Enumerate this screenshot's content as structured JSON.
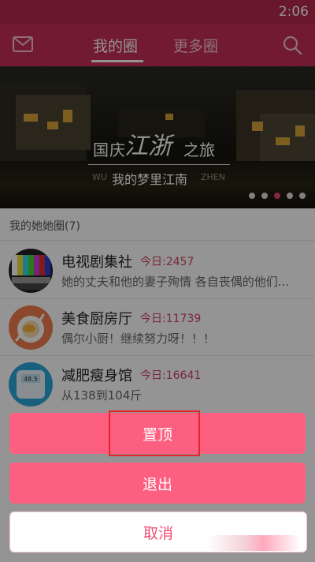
{
  "status_bar": {
    "time": "2:06"
  },
  "header": {
    "tabs": [
      {
        "label": "我的圈",
        "active": true
      },
      {
        "label": "更多圈",
        "active": false
      }
    ],
    "mail_icon": "mail-icon",
    "search_icon": "search-icon"
  },
  "banner": {
    "title_part1": "国庆",
    "title_big": "江浙",
    "title_part2": "之旅",
    "subtitle_left": "WU",
    "subtitle": "我的梦里江南",
    "subtitle_right": "ZHEN",
    "page_count": 5,
    "active_page_index": 2
  },
  "list": {
    "section_title": "我的她她圈(7)",
    "items": [
      {
        "name": "电视剧集社",
        "today": "今日:2457",
        "desc": "她的丈夫和他的妻子殉情 各自丧偶的他们..."
      },
      {
        "name": "美食厨房厅",
        "today": "今日:11739",
        "desc": "偶尔小厨！继续努力呀！！！"
      },
      {
        "name": "减肥瘦身馆",
        "today": "今日:16641",
        "desc": "从138到104斤"
      }
    ]
  },
  "action_sheet": {
    "pin_label": "置顶",
    "exit_label": "退出",
    "cancel_label": "取消"
  },
  "colors": {
    "brand": "#c32e57",
    "button": "#fd5f80",
    "today_text": "#d34368",
    "highlight": "#e8232a"
  }
}
